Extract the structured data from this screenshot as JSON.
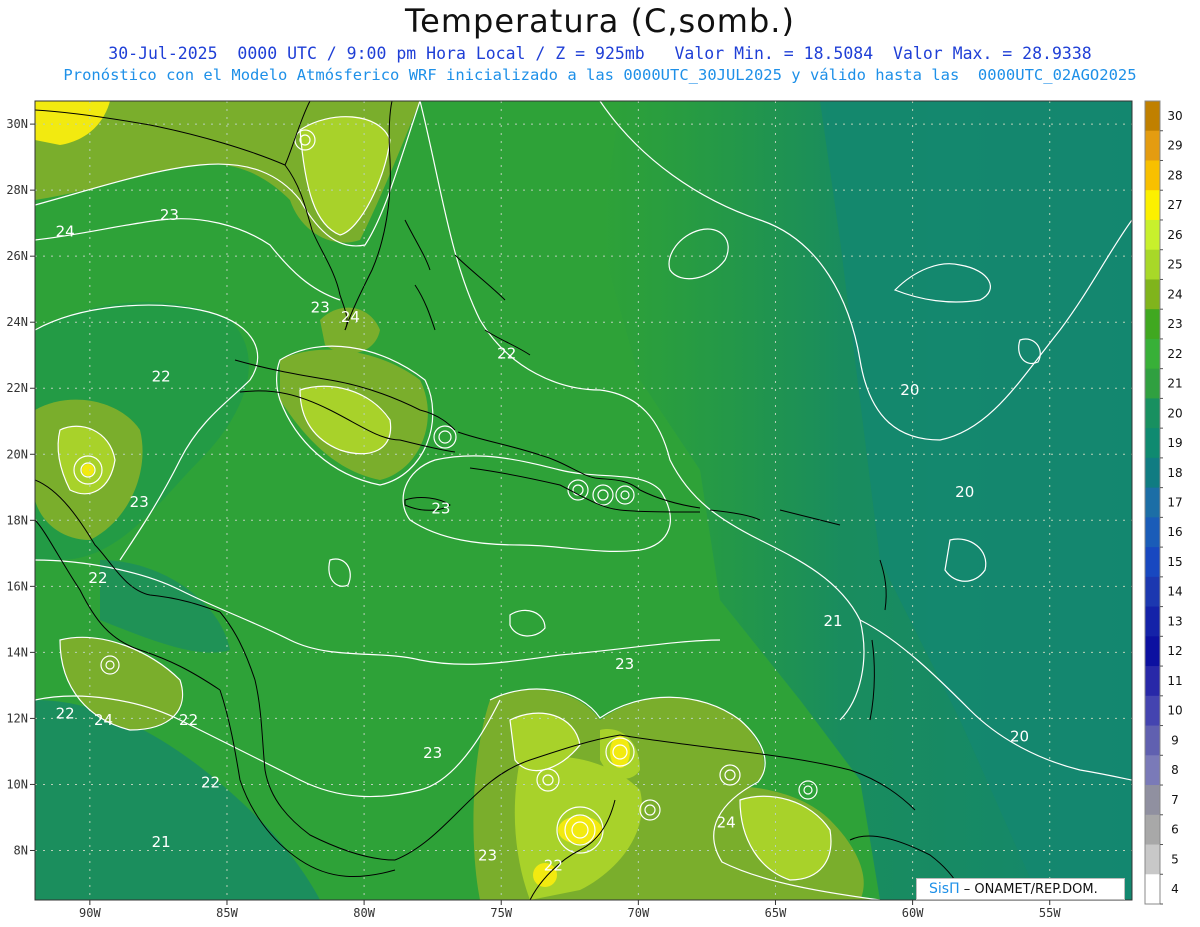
{
  "header": {
    "title": "Temperatura (C,somb.)",
    "line1": "30-Jul-2025  0000 UTC / 9:00 pm Hora Local / Z = 925mb   Valor Min. = 18.5084  Valor Max. = 28.9338",
    "line2": "Pronóstico con el Modelo Atmósferico WRF inicializado a las 0000UTC_30JUL2025 y válido hasta las  0000UTC_02AGO2025"
  },
  "map": {
    "lon_range": [
      -92,
      -52
    ],
    "lat_range": [
      6.5,
      30.7
    ],
    "lon_ticks": [
      "90W",
      "85W",
      "80W",
      "75W",
      "70W",
      "65W",
      "60W",
      "55W"
    ],
    "lat_ticks": [
      "30N",
      "28N",
      "26N",
      "24N",
      "22N",
      "20N",
      "18N",
      "16N",
      "14N",
      "12N",
      "10N",
      "8N"
    ],
    "contour_labels": [
      {
        "text": "24",
        "lon": -90.9,
        "lat": 26.6
      },
      {
        "text": "23",
        "lon": -87.1,
        "lat": 27.1
      },
      {
        "text": "23",
        "lon": -81.6,
        "lat": 24.3
      },
      {
        "text": "24",
        "lon": -80.5,
        "lat": 24.0
      },
      {
        "text": "22",
        "lon": -87.4,
        "lat": 22.2
      },
      {
        "text": "22",
        "lon": -74.8,
        "lat": 22.9
      },
      {
        "text": "23",
        "lon": -88.2,
        "lat": 18.4
      },
      {
        "text": "23",
        "lon": -77.2,
        "lat": 18.2
      },
      {
        "text": "22",
        "lon": -89.7,
        "lat": 16.1
      },
      {
        "text": "23",
        "lon": -70.5,
        "lat": 13.5
      },
      {
        "text": "21",
        "lon": -62.9,
        "lat": 14.8
      },
      {
        "text": "20",
        "lon": -60.1,
        "lat": 21.8
      },
      {
        "text": "20",
        "lon": -58.1,
        "lat": 18.7
      },
      {
        "text": "22",
        "lon": -90.9,
        "lat": 12.0
      },
      {
        "text": "24",
        "lon": -89.5,
        "lat": 11.8
      },
      {
        "text": "22",
        "lon": -86.4,
        "lat": 11.8
      },
      {
        "text": "23",
        "lon": -77.5,
        "lat": 10.8
      },
      {
        "text": "22",
        "lon": -85.6,
        "lat": 9.9
      },
      {
        "text": "21",
        "lon": -87.4,
        "lat": 8.1
      },
      {
        "text": "24",
        "lon": -66.8,
        "lat": 8.7
      },
      {
        "text": "20",
        "lon": -56.1,
        "lat": 11.3
      },
      {
        "text": "23",
        "lon": -75.5,
        "lat": 7.7
      },
      {
        "text": "22",
        "lon": -73.1,
        "lat": 7.4
      }
    ]
  },
  "colorbar": {
    "labels": [
      "30",
      "29",
      "28",
      "27",
      "26",
      "25",
      "24",
      "23",
      "22",
      "21",
      "20",
      "19",
      "18",
      "17",
      "16",
      "15",
      "14",
      "13",
      "12",
      "11",
      "10",
      "9",
      "8",
      "7",
      "6",
      "5",
      "4"
    ],
    "colors": [
      "#c08000",
      "#e49c10",
      "#f8c000",
      "#fcf000",
      "#c8f02c",
      "#a8d828",
      "#80b41c",
      "#40a820",
      "#38b038",
      "#30a040",
      "#189060",
      "#0f8a70",
      "#107c82",
      "#1c6ea6",
      "#1a5cb8",
      "#1848c0",
      "#1c38b0",
      "#1422a8",
      "#0c10a0",
      "#2828a8",
      "#4444b0",
      "#6060b0",
      "#7a7ab8",
      "#9090a0",
      "#a8a8a8",
      "#c8c8c8",
      "#ffffff"
    ]
  },
  "credit": {
    "logo": "SisΠ",
    "text": "– ONAMET/REP.DOM."
  },
  "colors": {
    "background_green": "#2ea238",
    "warm_olive": "#7aae2c",
    "lime": "#a8d22a",
    "yellow": "#f2ea10",
    "cool_teal": "#16876a",
    "contour": "#ffffff",
    "title_blue": "#1f3fd6",
    "subtitle_blue": "#1e90e8"
  }
}
